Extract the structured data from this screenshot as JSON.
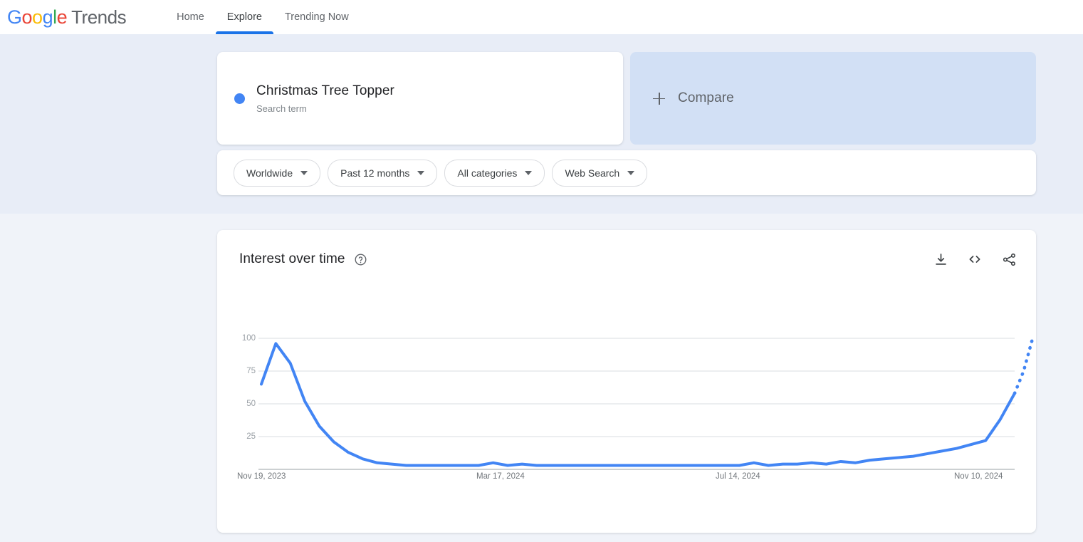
{
  "header": {
    "brand_google": "Google",
    "brand_trends": "Trends",
    "nav": [
      {
        "label": "Home",
        "active": false
      },
      {
        "label": "Explore",
        "active": true
      },
      {
        "label": "Trending Now",
        "active": false
      }
    ]
  },
  "query": {
    "term": "Christmas Tree Topper",
    "term_type": "Search term",
    "term_color": "#4285F4",
    "compare_label": "Compare"
  },
  "filters": [
    {
      "label": "Worldwide"
    },
    {
      "label": "Past 12 months"
    },
    {
      "label": "All categories"
    },
    {
      "label": "Web Search"
    }
  ],
  "chart_card": {
    "title": "Interest over time",
    "help_icon": "question-mark-circle-icon",
    "actions": [
      {
        "name": "download-icon"
      },
      {
        "name": "embed-code-icon"
      },
      {
        "name": "share-icon"
      }
    ]
  },
  "chart_data": {
    "type": "line",
    "title": "Interest over time",
    "xlabel": "",
    "ylabel": "",
    "ylim": [
      0,
      100
    ],
    "yticks": [
      25,
      50,
      75,
      100
    ],
    "ytick_labels": [
      "25",
      "50",
      "75",
      "100"
    ],
    "xtick_labels": [
      "Nov 19, 2023",
      "Mar 17, 2024",
      "Jul 14, 2024",
      "Nov 10, 2024"
    ],
    "xtick_positions": [
      0,
      0.3208,
      0.6415,
      0.9623
    ],
    "grid": true,
    "legend": "none",
    "line_color": "#4285F4",
    "series": [
      {
        "name": "Christmas Tree Topper",
        "x": [
          "Nov 19, 2023",
          "Nov 26, 2023",
          "Dec 3, 2023",
          "Dec 10, 2023",
          "Dec 17, 2023",
          "Dec 24, 2023",
          "Dec 31, 2023",
          "Jan 7, 2024",
          "Jan 14, 2024",
          "Jan 21, 2024",
          "Jan 28, 2024",
          "Feb 4, 2024",
          "Feb 11, 2024",
          "Feb 18, 2024",
          "Feb 25, 2024",
          "Mar 3, 2024",
          "Mar 10, 2024",
          "Mar 17, 2024",
          "Mar 24, 2024",
          "Mar 31, 2024",
          "Apr 7, 2024",
          "Apr 14, 2024",
          "Apr 21, 2024",
          "Apr 28, 2024",
          "May 5, 2024",
          "May 12, 2024",
          "May 19, 2024",
          "May 26, 2024",
          "Jun 2, 2024",
          "Jun 9, 2024",
          "Jun 16, 2024",
          "Jun 23, 2024",
          "Jun 30, 2024",
          "Jul 7, 2024",
          "Jul 14, 2024",
          "Jul 21, 2024",
          "Jul 28, 2024",
          "Aug 4, 2024",
          "Aug 11, 2024",
          "Aug 18, 2024",
          "Aug 25, 2024",
          "Sep 1, 2024",
          "Sep 8, 2024",
          "Sep 15, 2024",
          "Sep 22, 2024",
          "Sep 29, 2024",
          "Oct 6, 2024",
          "Oct 13, 2024",
          "Oct 20, 2024",
          "Oct 27, 2024",
          "Nov 3, 2024",
          "Nov 10, 2024",
          "Nov 17, 2024"
        ],
        "values": [
          65,
          96,
          81,
          52,
          33,
          21,
          13,
          8,
          5,
          4,
          3,
          3,
          3,
          3,
          3,
          3,
          5,
          3,
          4,
          3,
          3,
          3,
          3,
          3,
          3,
          3,
          3,
          3,
          3,
          3,
          3,
          3,
          3,
          3,
          5,
          3,
          4,
          4,
          5,
          4,
          6,
          5,
          7,
          8,
          9,
          10,
          12,
          14,
          16,
          19,
          22,
          38,
          58
        ],
        "solid_end_index": 52,
        "forecast_values": [
          58,
          75,
          100
        ],
        "forecast_note": "partial-data-dotted-segment"
      }
    ]
  }
}
